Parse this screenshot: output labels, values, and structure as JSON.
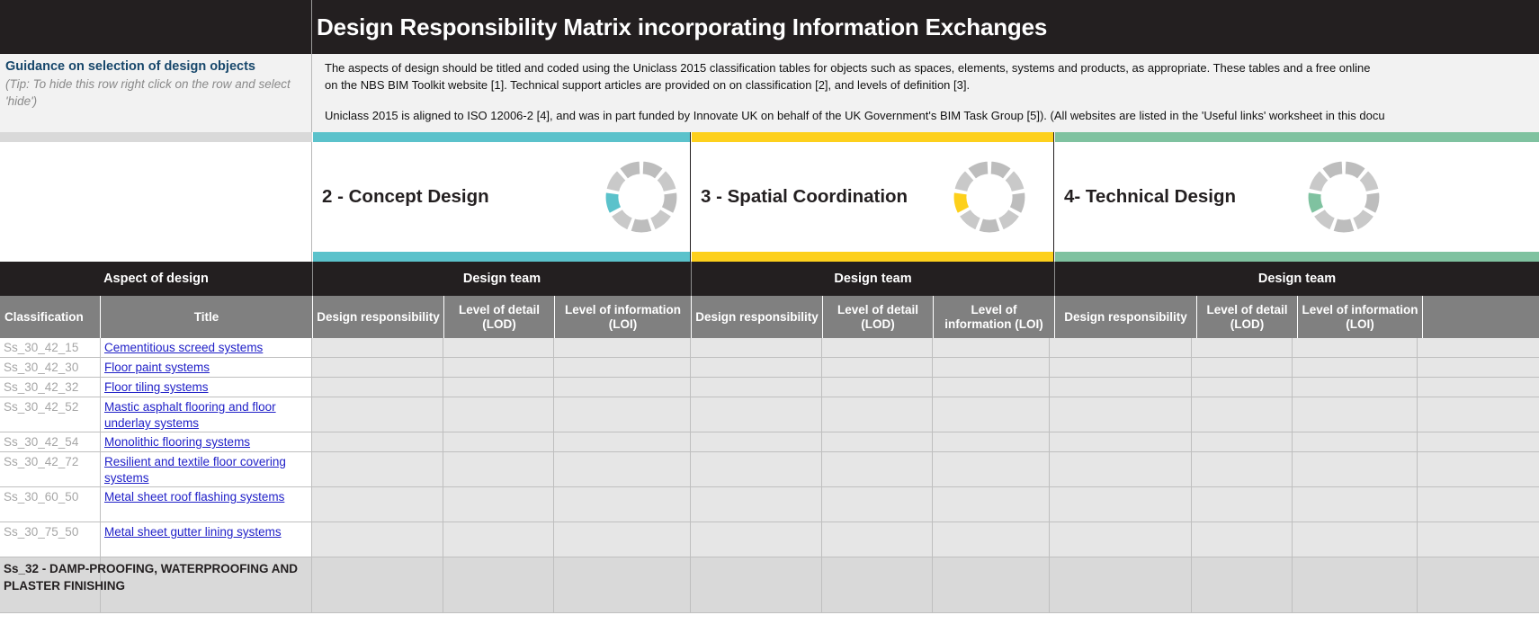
{
  "header": {
    "title": "Design Responsibility Matrix incorporating Information Exchanges"
  },
  "guidance": {
    "title": "Guidance on selection of design objects",
    "tip": "(Tip: To hide this row right click on the row and select 'hide')",
    "paragraph1": "The aspects of design should be titled and coded using the Uniclass 2015 classification tables for objects such as spaces, elements, systems and products, as appropriate. These tables and a free online",
    "paragraph1b": "on the NBS BIM Toolkit website [1]. Technical support articles are provided on on classification [2], and levels of definition [3].",
    "paragraph2": "Uniclass 2015 is aligned to ISO 12006-2 [4], and was in part funded by Innovate UK  on behalf of the UK Government's BIM Task Group [5]). (All websites are listed in the 'Useful links' worksheet in this docu"
  },
  "stages": [
    {
      "name": "2 - Concept Design",
      "color": "#5bc2cb",
      "team_label": "Design team",
      "donut_icon": "segmented-ring-icon",
      "columns": [
        {
          "label": "Design responsibility",
          "has_comment": true
        },
        {
          "label": "Level of detail (LOD)",
          "has_comment": true
        },
        {
          "label": "Level of information (LOI)",
          "has_comment": true
        }
      ]
    },
    {
      "name": "3 - Spatial Coordination",
      "color": "#fdd01c",
      "team_label": "Design team",
      "donut_icon": "segmented-ring-icon",
      "columns": [
        {
          "label": "Design responsibility",
          "has_comment": true
        },
        {
          "label": "Level of detail (LOD)",
          "has_comment": true
        },
        {
          "label": "Level of information (LOI)",
          "has_comment": true
        }
      ]
    },
    {
      "name": "4- Technical Design",
      "color": "#7fc2a0",
      "team_label": "Design team",
      "donut_icon": "segmented-ring-icon",
      "columns": [
        {
          "label": "Design responsibility",
          "has_comment": true
        },
        {
          "label": "Level of detail (LOD)",
          "has_comment": true
        },
        {
          "label": "Level of information (LOI)",
          "has_comment": true
        }
      ]
    }
  ],
  "aspect": {
    "group_label": "Aspect of design",
    "col_classification": "Classification",
    "col_title": "Title"
  },
  "rows": [
    {
      "classification": "Ss_30_42_15",
      "title": "Cementitious screed systems",
      "type": "item"
    },
    {
      "classification": "Ss_30_42_30",
      "title": "Floor paint systems",
      "type": "item"
    },
    {
      "classification": "Ss_30_42_32",
      "title": "Floor tiling systems",
      "type": "item"
    },
    {
      "classification": "Ss_30_42_52",
      "title": "Mastic asphalt flooring and floor underlay systems",
      "type": "item"
    },
    {
      "classification": "Ss_30_42_54",
      "title": "Monolithic flooring systems",
      "type": "item"
    },
    {
      "classification": "Ss_30_42_72",
      "title": "Resilient and textile floor covering systems",
      "type": "item"
    },
    {
      "classification": "Ss_30_60_50",
      "title": "Metal sheet roof flashing systems",
      "type": "item"
    },
    {
      "classification": "Ss_30_75_50",
      "title": "Metal sheet gutter lining systems",
      "type": "item"
    },
    {
      "classification": "",
      "title": "Ss_32 - DAMP-PROOFING, WATERPROOFING AND PLASTER FINISHING",
      "type": "group"
    }
  ],
  "colors": {
    "dark": "#231f20",
    "header_gray": "#808080",
    "cell_gray": "#e6e6e6",
    "group_gray": "#d9d9d9",
    "link_blue": "#2121c8",
    "guide_blue": "#17476b",
    "comment_red": "#ff0000"
  }
}
